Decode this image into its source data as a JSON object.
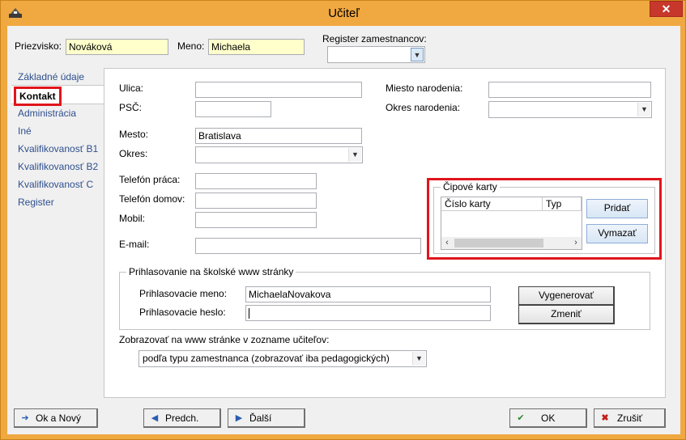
{
  "window": {
    "title": "Učiteľ",
    "close_glyph": "✕"
  },
  "header": {
    "surname_label": "Priezvisko:",
    "surname_value": "Nováková",
    "firstname_label": "Meno:",
    "firstname_value": "Michaela",
    "register_label": "Register zamestnancov:",
    "register_value": ""
  },
  "sidebar": {
    "items": [
      {
        "label": "Základné údaje"
      },
      {
        "label": "Kontakt"
      },
      {
        "label": "Administrácia"
      },
      {
        "label": "Iné"
      },
      {
        "label": "Kvalifikovanosť B1"
      },
      {
        "label": "Kvalifikovanosť B2"
      },
      {
        "label": "Kvalifikovanosť C"
      },
      {
        "label": "Register"
      }
    ],
    "active": "Kontakt"
  },
  "contact": {
    "street_label": "Ulica:",
    "street_value": "",
    "zip_label": "PSČ:",
    "zip_value": "",
    "city_label": "Mesto:",
    "city_value": "Bratislava",
    "district_label": "Okres:",
    "district_value": "",
    "phone_work_label": "Telefón práca:",
    "phone_work_value": "",
    "phone_home_label": "Telefón domov:",
    "phone_home_value": "",
    "mobile_label": "Mobil:",
    "mobile_value": "",
    "email_label": "E-mail:",
    "email_value": "",
    "birthplace_label": "Miesto narodenia:",
    "birthplace_value": "",
    "birth_district_label": "Okres narodenia:",
    "birth_district_value": ""
  },
  "chip_cards": {
    "group_title": "Čipové karty",
    "columns": [
      "Číslo karty",
      "Typ"
    ],
    "rows": [],
    "add_label": "Pridať",
    "delete_label": "Vymazať"
  },
  "school_login": {
    "group_title": "Prihlasovanie na školské www stránky",
    "login_label": "Prihlasovacie meno:",
    "login_value": "MichaelaNovakova",
    "password_label": "Prihlasovacie heslo:",
    "password_value": "",
    "generate_label": "Vygenerovať",
    "change_label": "Zmeniť"
  },
  "web_display": {
    "label": "Zobrazovať na www stránke v zozname učiteľov:",
    "value": "podľa typu zamestnanca (zobrazovať iba pedagogických)"
  },
  "footer": {
    "ok_new_label": "Ok a Nový",
    "prev_label": "Predch.",
    "next_label": "Ďalší",
    "ok_label": "OK",
    "cancel_label": "Zrušiť"
  },
  "colors": {
    "window_frame": "#f0a840",
    "highlight_red": "#e0151c",
    "sidebar_link": "#2e4f8d",
    "name_field_bg": "#ffffcc"
  },
  "icons": [
    "app-icon",
    "close-icon",
    "chevron-down-icon",
    "arrow-right-icon",
    "arrow-left-icon",
    "ok-check-icon",
    "cancel-x-icon"
  ]
}
